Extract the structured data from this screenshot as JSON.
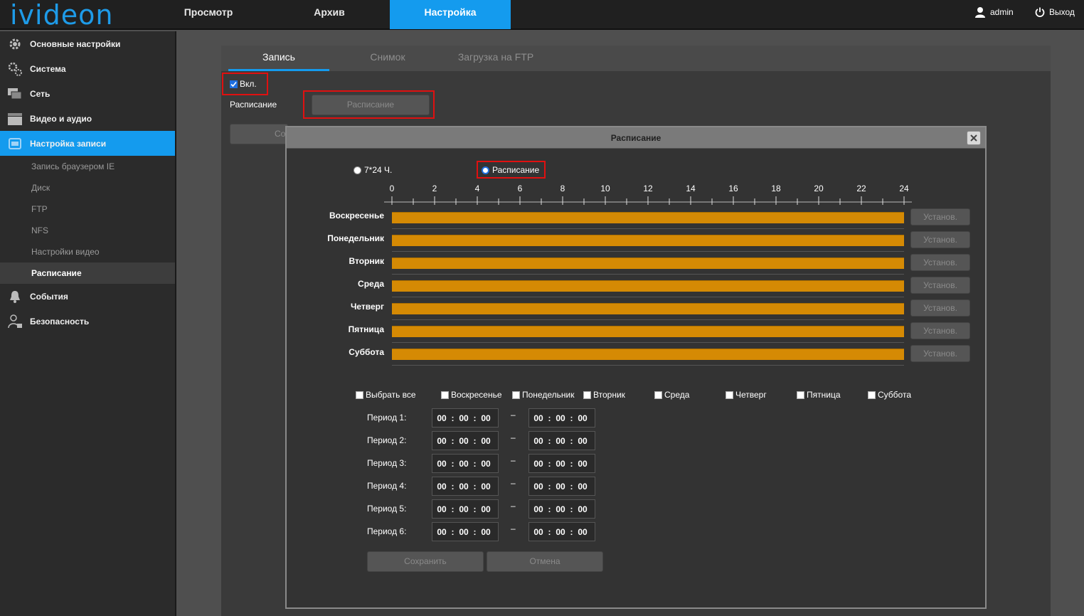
{
  "header": {
    "logo": "ivideon",
    "nav": [
      "Просмотр",
      "Архив",
      "Настройка"
    ],
    "active_nav": "Настройка",
    "user": "admin",
    "logout": "Выход"
  },
  "sidebar": {
    "items": [
      {
        "label": "Основные настройки",
        "icon": "gear-icon"
      },
      {
        "label": "Система",
        "icon": "gears-icon"
      },
      {
        "label": "Сеть",
        "icon": "network-icon"
      },
      {
        "label": "Видео и аудио",
        "icon": "clapper-icon"
      },
      {
        "label": "Настройка записи",
        "icon": "record-icon",
        "active": true
      }
    ],
    "subitems": [
      "Запись браузером IE",
      "Диск",
      "FTP",
      "NFS",
      "Настройки видео",
      "Расписание"
    ],
    "active_subitem": "Расписание",
    "bottom_items": [
      {
        "label": "События",
        "icon": "bell-icon"
      },
      {
        "label": "Безопасность",
        "icon": "user-lock-icon"
      }
    ]
  },
  "tabs": [
    "Запись",
    "Снимок",
    "Загрузка на FTP"
  ],
  "active_tab": "Запись",
  "record": {
    "enable_label": "Вкл.",
    "enabled": true,
    "schedule_label": "Расписание",
    "schedule_button": "Расписание",
    "hidden_button_fragment": "Со"
  },
  "dialog": {
    "title": "Расписание",
    "mode_options": [
      "7*24 Ч.",
      "Расписание"
    ],
    "selected_mode": "Расписание",
    "hours": [
      "0",
      "2",
      "4",
      "6",
      "8",
      "10",
      "12",
      "14",
      "16",
      "18",
      "20",
      "22",
      "24"
    ],
    "days": [
      "Воскресенье",
      "Понедельник",
      "Вторник",
      "Среда",
      "Четверг",
      "Пятница",
      "Суббота"
    ],
    "day_coverage": [
      [
        0,
        24
      ],
      [
        0,
        24
      ],
      [
        0,
        24
      ],
      [
        0,
        24
      ],
      [
        0,
        24
      ],
      [
        0,
        24
      ],
      [
        0,
        24
      ]
    ],
    "set_button": "Установ.",
    "checkboxes": [
      "Выбрать все",
      "Воскресенье",
      "Понедельник",
      "Вторник",
      "Среда",
      "Четверг",
      "Пятница",
      "Суббота"
    ],
    "periods": [
      {
        "label": "Период 1:",
        "start": [
          "00",
          "00",
          "00"
        ],
        "end": [
          "00",
          "00",
          "00"
        ]
      },
      {
        "label": "Период 2:",
        "start": [
          "00",
          "00",
          "00"
        ],
        "end": [
          "00",
          "00",
          "00"
        ]
      },
      {
        "label": "Период 3:",
        "start": [
          "00",
          "00",
          "00"
        ],
        "end": [
          "00",
          "00",
          "00"
        ]
      },
      {
        "label": "Период 4:",
        "start": [
          "00",
          "00",
          "00"
        ],
        "end": [
          "00",
          "00",
          "00"
        ]
      },
      {
        "label": "Период 5:",
        "start": [
          "00",
          "00",
          "00"
        ],
        "end": [
          "00",
          "00",
          "00"
        ]
      },
      {
        "label": "Период 6:",
        "start": [
          "00",
          "00",
          "00"
        ],
        "end": [
          "00",
          "00",
          "00"
        ]
      }
    ],
    "dash": "–",
    "save_button": "Сохранить",
    "cancel_button": "Отмена"
  },
  "colors": {
    "accent": "#149bee",
    "bar": "#d58a04",
    "highlight": "#e01010"
  }
}
